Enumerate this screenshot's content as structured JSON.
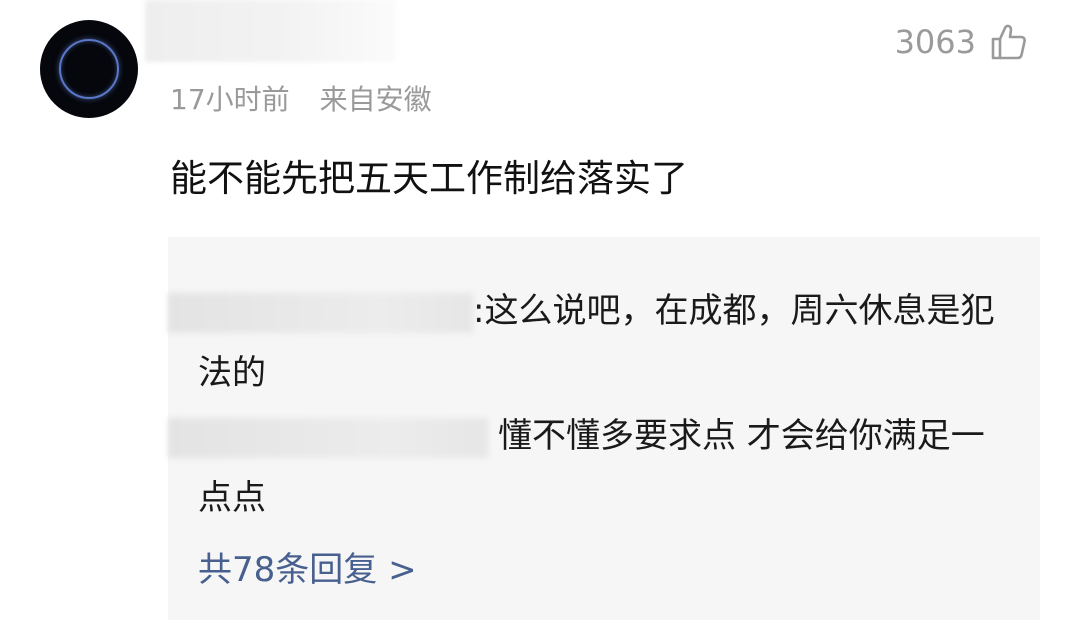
{
  "comment": {
    "meta": {
      "time": "17小时前",
      "location": "来自安徽"
    },
    "likes": {
      "count": "3063",
      "icon": "thumbs-up-icon"
    },
    "text": "能不能先把五天工作制给落实了"
  },
  "replies": {
    "items": [
      {
        "separator": ":",
        "text": "这么说吧，在成都，周六休息是犯法的"
      },
      {
        "text": "懂不懂多要求点 才会给你满足一点点"
      }
    ],
    "more_label": "共78条回复 >"
  },
  "colors": {
    "meta_gray": "#9a9a9a",
    "link_blue": "#48608f",
    "reply_bg": "#f6f6f6"
  }
}
